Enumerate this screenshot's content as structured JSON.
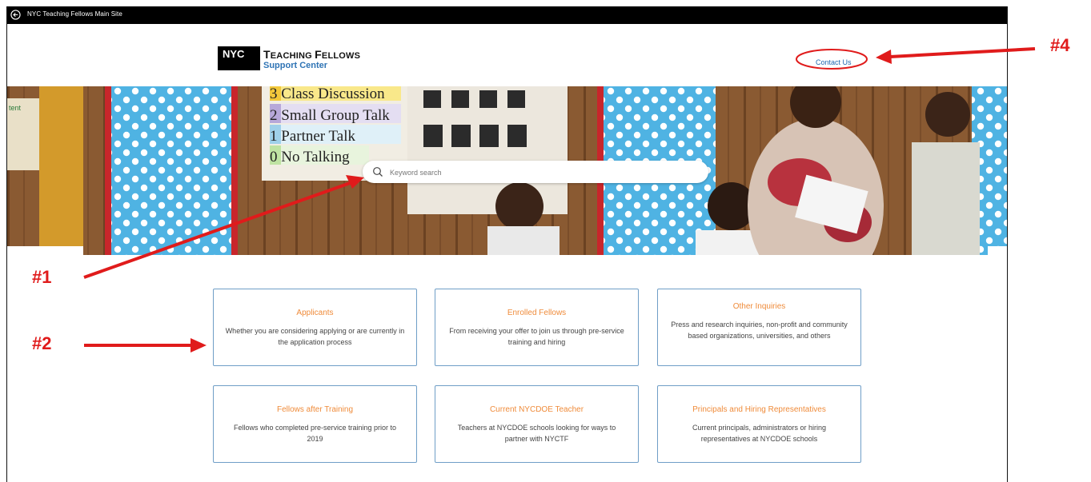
{
  "topbar": {
    "back_label": "NYC Teaching Fellows Main Site"
  },
  "header": {
    "logo_nyc": "NYC",
    "logo_title_t": "T",
    "logo_title_rest1": "EACHING ",
    "logo_title_f": "F",
    "logo_title_rest2": "ELLOWS",
    "logo_subtitle": "Support Center",
    "contact_label": "Contact Us"
  },
  "hero": {
    "poster_lines": [
      "3 Class Discussion",
      "2 Small Group Talk",
      "1 Partner Talk",
      "0 No Talking"
    ],
    "corner_text": "tent"
  },
  "search": {
    "placeholder": "Keyword search"
  },
  "cards": [
    {
      "title": "Applicants",
      "desc": "Whether you are considering applying or are currently in the application process"
    },
    {
      "title": "Enrolled Fellows",
      "desc": "From receiving your offer to join us through pre-service training and hiring"
    },
    {
      "title": "Other Inquiries",
      "desc": "Press and research inquiries, non-profit and community based organizations, universities, and others"
    },
    {
      "title": "Fellows after Training",
      "desc": "Fellows who completed pre-service training prior to 2019"
    },
    {
      "title": "Current NYCDOE Teacher",
      "desc": "Teachers at NYCDOE schools looking for ways to partner with NYCTF"
    },
    {
      "title": "Principals and Hiring Representatives",
      "desc": "Current principals, administrators or hiring representatives at NYCDOE schools"
    }
  ],
  "annotations": {
    "a1": "#1",
    "a2": "#2",
    "a4": "#4"
  },
  "colors": {
    "accent_orange": "#ef8b3a",
    "link_blue": "#1f67b1",
    "annotation_red": "#e01b1b",
    "card_border": "#6f9ec7"
  }
}
